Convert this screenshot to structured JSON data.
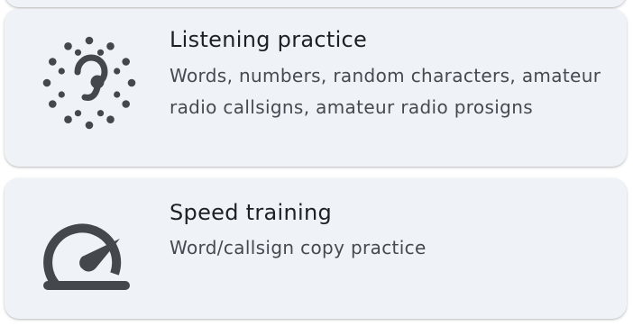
{
  "cards": [
    {
      "title": "Listening practice",
      "subtitle": "Words, numbers, random characters, amateur radio callsigns, amateur radio prosigns",
      "icon": "hearing-icon"
    },
    {
      "title": "Speed training",
      "subtitle": "Word/callsign copy practice",
      "icon": "speed-icon"
    }
  ],
  "colors": {
    "card_background": "#eff3f8",
    "icon": "#44474c",
    "title": "#1d2126",
    "subtitle": "#454a50"
  }
}
